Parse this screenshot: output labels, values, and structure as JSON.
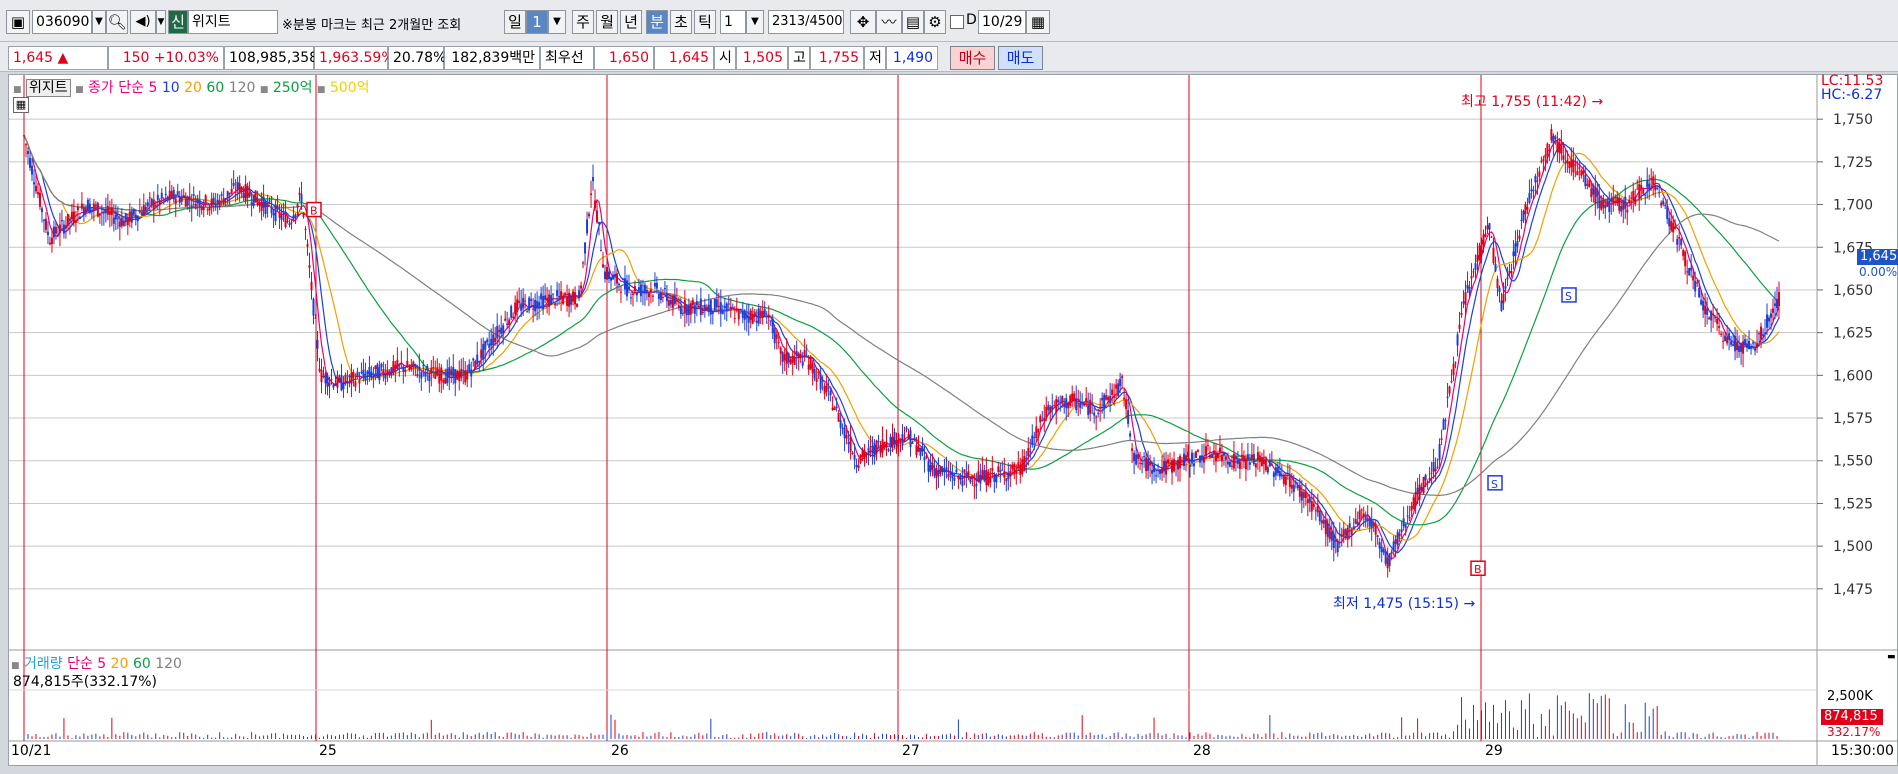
{
  "toolbar": {
    "code": "036090",
    "market_badge": "신",
    "name": "위지트",
    "notice": "※분봉 마크는 최근 2개월만 조회",
    "period_day": "일",
    "period_n": "1",
    "week": "주",
    "month": "월",
    "year": "년",
    "minute": "분",
    "second": "초",
    "tick": "틱",
    "interval": "1",
    "count": "2313/4500",
    "d_label": "D",
    "date": "10/29"
  },
  "quote": {
    "price": "1,645 ▲",
    "change": "150 +10.03%",
    "volume": "108,985,358",
    "volume_ratio": "1,963.59%",
    "turnover": "20.78%",
    "amount": "182,839백만",
    "best_label": "최우선",
    "best_ask": "1,650",
    "best_bid": "1,645",
    "open_label": "시",
    "open": "1,505",
    "high_label": "고",
    "high": "1,755",
    "low_label": "저",
    "low": "1,490",
    "buy": "매수",
    "sell": "매도"
  },
  "price_panel": {
    "name_tag": "위지트",
    "ma_label": "종가 단순",
    "ma_periods": [
      "5",
      "10",
      "20",
      "60",
      "120"
    ],
    "ma_colors": [
      "#e8007a",
      "#1d3fd8",
      "#f0a000",
      "#0aa040",
      "#808080"
    ],
    "amount_lines": [
      "250억",
      "500억"
    ],
    "lc": "LC:11.53",
    "hc": "HC:-6.27",
    "current_price": "1,645",
    "current_pct": "0.00%",
    "high_note": "최고 1,755 (11:42)",
    "low_note": "최저 1,475 (15:15)",
    "signal_b": "B",
    "signal_s": "S"
  },
  "volume_panel": {
    "label": "거래량",
    "ma_label": "단순",
    "ma_periods": [
      "5",
      "20",
      "60",
      "120"
    ],
    "current": "874,815주(332.17%)",
    "axis_label": "2,500K",
    "last_value": "874,815",
    "last_pct": "332.17%"
  },
  "time_axis": {
    "labels": [
      "10/21",
      "25",
      "26",
      "27",
      "28",
      "29"
    ],
    "end_time": "15:30:00"
  },
  "chart_data": {
    "type": "candlestick",
    "y_ticks": [
      1750,
      1725,
      1700,
      1675,
      1650,
      1625,
      1600,
      1575,
      1550,
      1525,
      1500,
      1475
    ],
    "ylim": [
      1455,
      1770
    ],
    "days": [
      "10/21",
      "10/25",
      "10/26",
      "10/27",
      "10/28",
      "10/29"
    ],
    "price_path": [
      [
        0,
        1740
      ],
      [
        0.02,
        1680
      ],
      [
        0.05,
        1700
      ],
      [
        0.08,
        1690
      ],
      [
        0.1,
        1700
      ],
      [
        0.12,
        1705
      ],
      [
        0.15,
        1700
      ],
      [
        0.17,
        1710
      ],
      [
        0.19,
        1700
      ],
      [
        0.21,
        1690
      ],
      [
        0.22,
        1705
      ],
      [
        0.235,
        1600
      ],
      [
        0.25,
        1595
      ],
      [
        0.27,
        1600
      ],
      [
        0.3,
        1605
      ],
      [
        0.33,
        1600
      ],
      [
        0.35,
        1600
      ],
      [
        0.37,
        1620
      ],
      [
        0.39,
        1640
      ],
      [
        0.42,
        1645
      ],
      [
        0.44,
        1645
      ],
      [
        0.45,
        1715
      ],
      [
        0.46,
        1660
      ],
      [
        0.48,
        1650
      ],
      [
        0.5,
        1650
      ],
      [
        0.52,
        1640
      ],
      [
        0.55,
        1640
      ],
      [
        0.57,
        1635
      ],
      [
        0.59,
        1635
      ],
      [
        0.6,
        1610
      ],
      [
        0.62,
        1610
      ],
      [
        0.64,
        1585
      ],
      [
        0.66,
        1550
      ],
      [
        0.68,
        1560
      ],
      [
        0.7,
        1565
      ],
      [
        0.72,
        1545
      ],
      [
        0.74,
        1540
      ],
      [
        0.76,
        1540
      ],
      [
        0.79,
        1545
      ],
      [
        0.81,
        1580
      ],
      [
        0.83,
        1585
      ],
      [
        0.85,
        1580
      ],
      [
        0.87,
        1595
      ],
      [
        0.88,
        1550
      ],
      [
        0.9,
        1545
      ],
      [
        0.92,
        1550
      ],
      [
        0.94,
        1555
      ],
      [
        0.96,
        1550
      ],
      [
        0.98,
        1550
      ],
      [
        1.0,
        1540
      ],
      [
        1.02,
        1525
      ],
      [
        1.04,
        1500
      ],
      [
        1.06,
        1520
      ],
      [
        1.07,
        1510
      ],
      [
        1.08,
        1490
      ],
      [
        1.1,
        1525
      ],
      [
        1.12,
        1550
      ],
      [
        1.14,
        1640
      ],
      [
        1.16,
        1690
      ],
      [
        1.17,
        1640
      ],
      [
        1.19,
        1700
      ],
      [
        1.21,
        1740
      ],
      [
        1.23,
        1720
      ],
      [
        1.25,
        1700
      ],
      [
        1.27,
        1700
      ],
      [
        1.29,
        1715
      ],
      [
        1.31,
        1680
      ],
      [
        1.33,
        1640
      ],
      [
        1.35,
        1620
      ],
      [
        1.37,
        1615
      ],
      [
        1.39,
        1645
      ]
    ]
  }
}
